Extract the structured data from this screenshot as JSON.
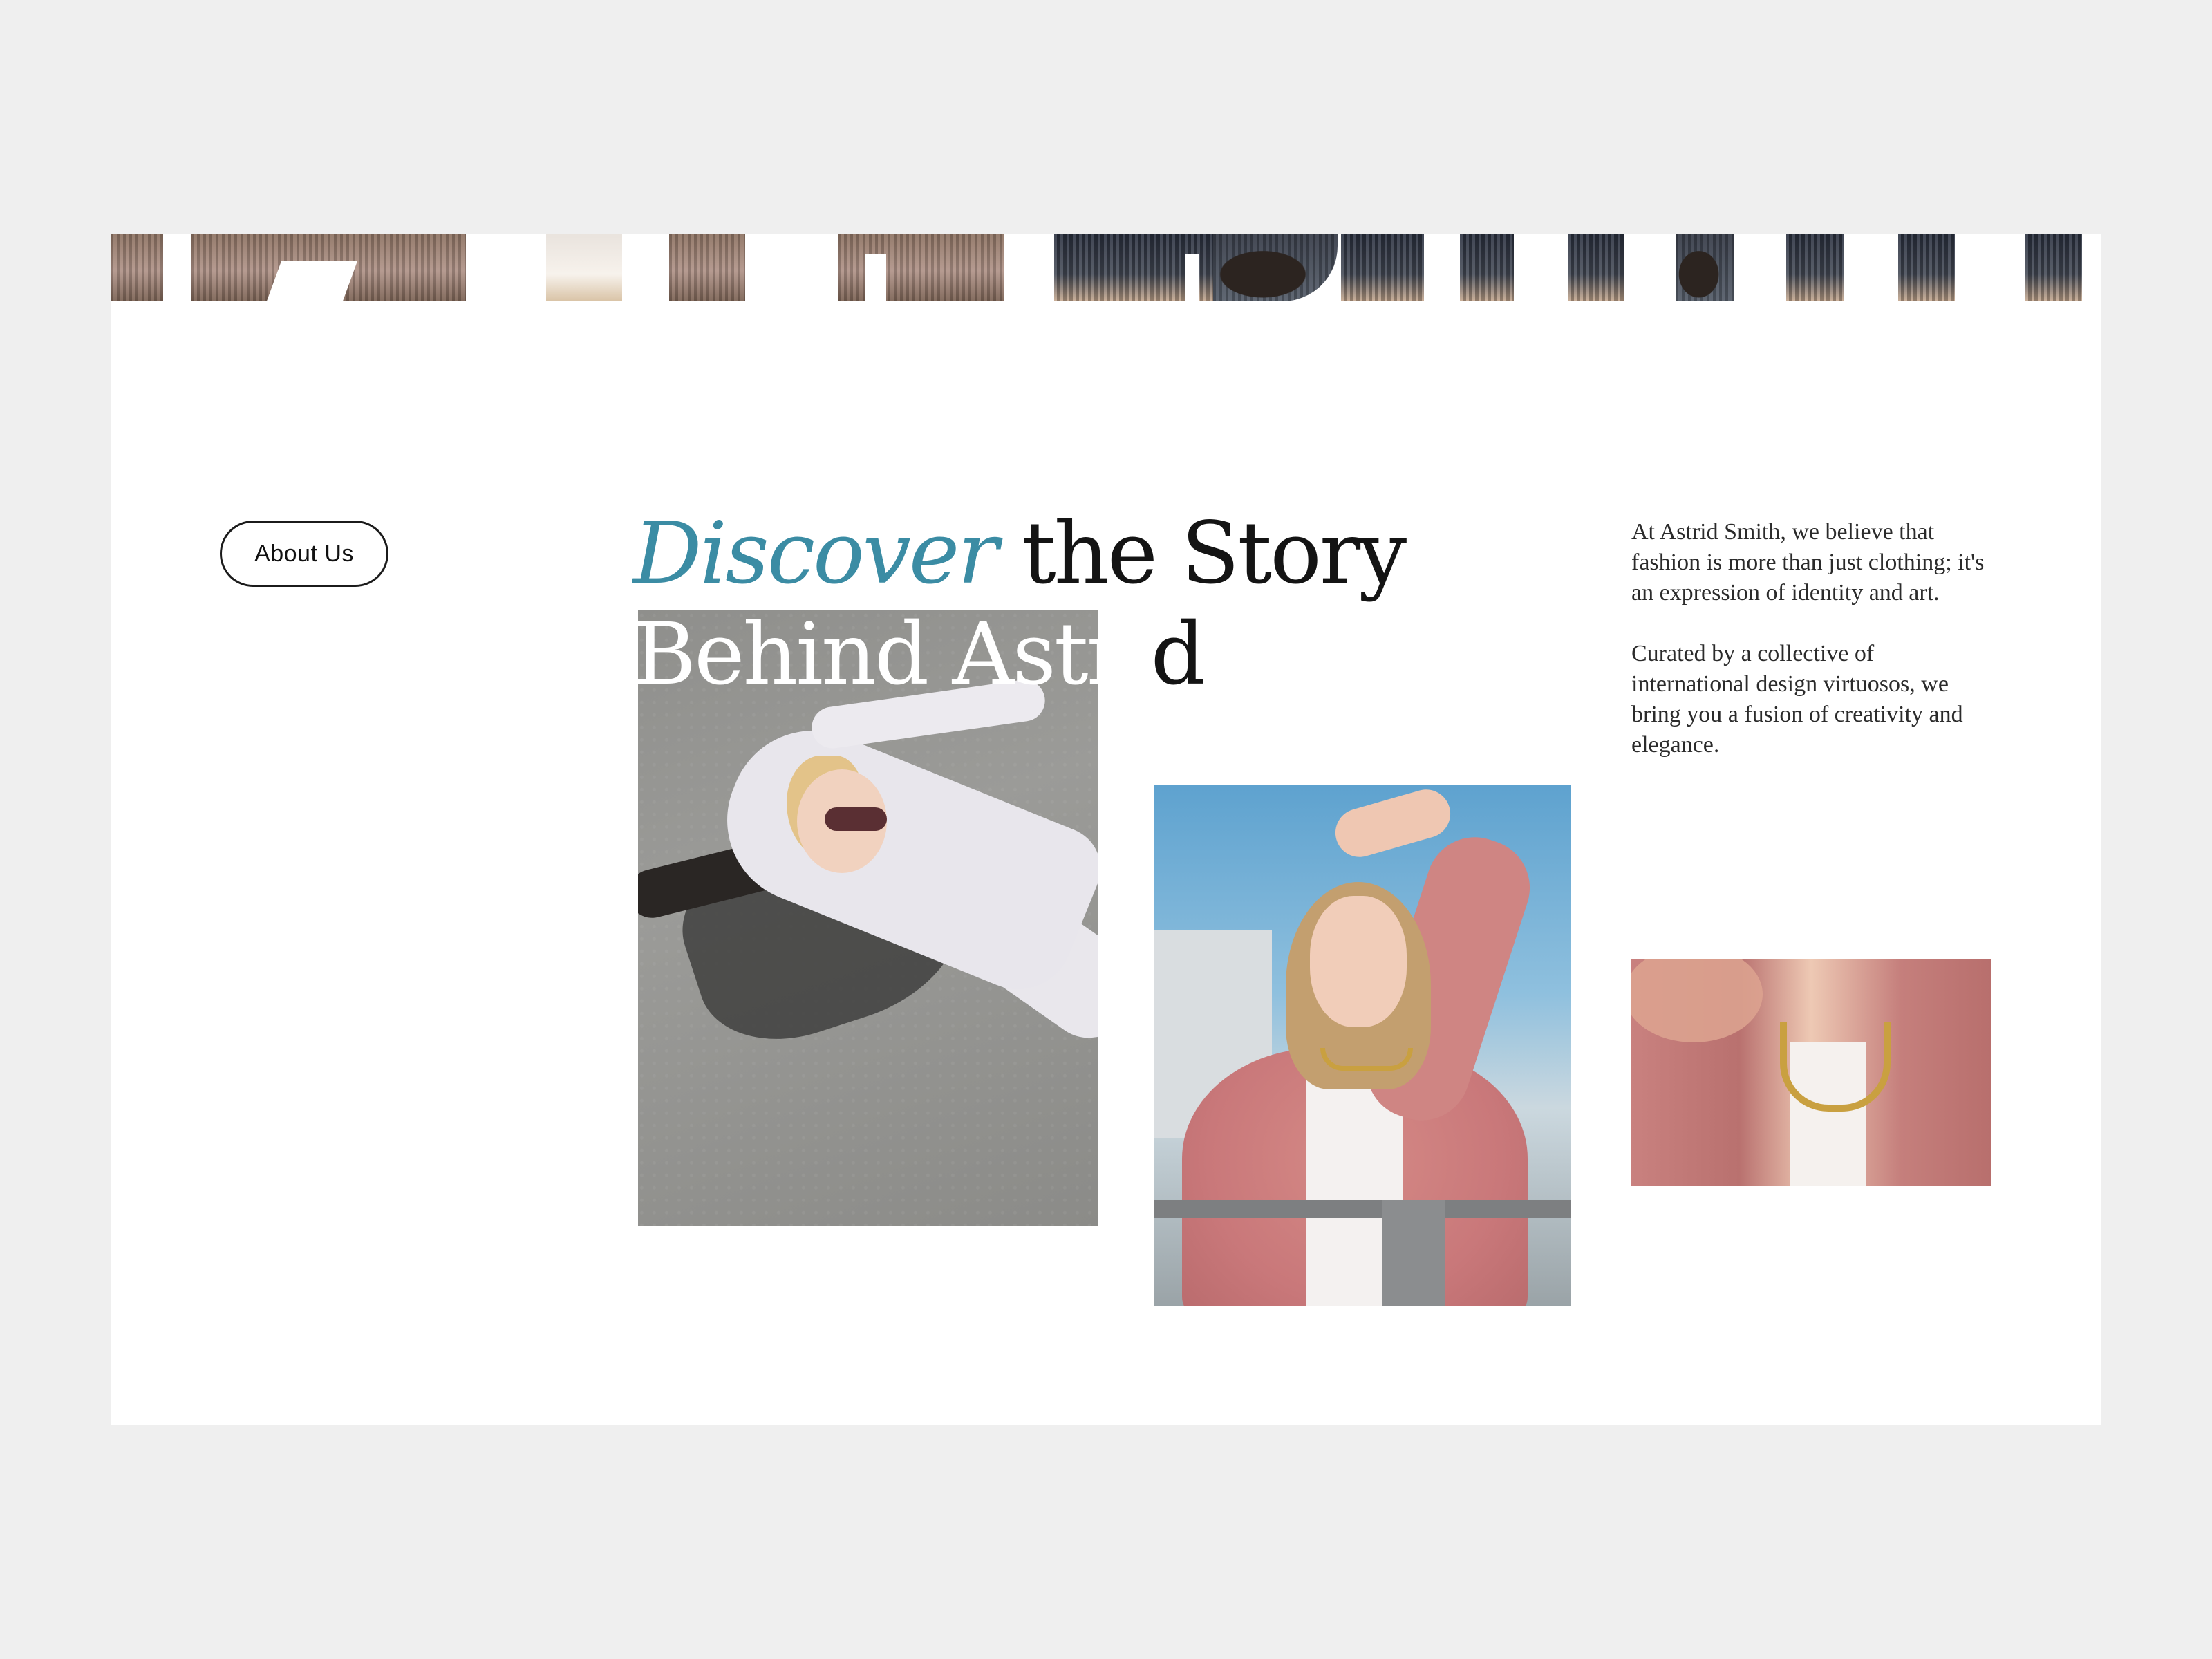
{
  "about_button": {
    "label": "About Us"
  },
  "headline": {
    "accent": "Discover",
    "rest_line1": " the Story",
    "line2_on_photo": "Behind Astri",
    "line2_tail": "d"
  },
  "copy": {
    "paragraph1": "At Astrid Smith, we believe that fashion is more than just clothing; it's an expression of identity and art.",
    "paragraph2": "Curated by a collective of international design virtuosos, we bring you a fusion of creativity and elegance."
  },
  "colors": {
    "accent": "#3b8ca4",
    "page_background": "#efefef",
    "card_background": "#ffffff",
    "text": "#141414"
  }
}
